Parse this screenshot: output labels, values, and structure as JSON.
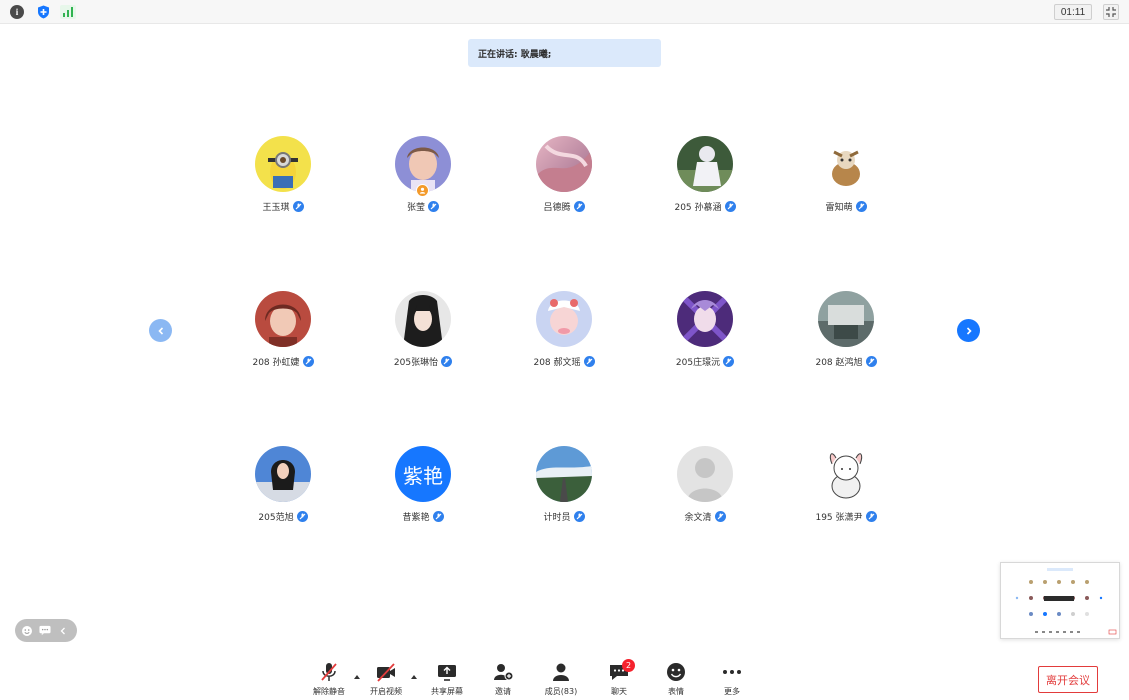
{
  "topbar": {
    "timer": "01:11",
    "icons": [
      "info-icon",
      "shield-icon",
      "signal-icon",
      "exit-fullscreen-icon"
    ]
  },
  "speaking": {
    "text": "正在讲话: 耿晨曦;"
  },
  "participants": [
    {
      "name": "王玉琪"
    },
    {
      "name": "张莹"
    },
    {
      "name": "吕德腾"
    },
    {
      "name": "205 孙慕涵"
    },
    {
      "name": "雷知萌"
    },
    {
      "name": "208 孙虹婕"
    },
    {
      "name": "205张琳怡"
    },
    {
      "name": "208 郝文瑶"
    },
    {
      "name": "205庄璟沅"
    },
    {
      "name": "208 赵鸿旭"
    },
    {
      "name": "205范旭"
    },
    {
      "name": "昔紫艳",
      "avatar_text": "紫艳"
    },
    {
      "name": "计时员"
    },
    {
      "name": "余文清"
    },
    {
      "name": "195 张潇尹"
    }
  ],
  "toolbar": {
    "unmute": "解除静音",
    "start_video": "开启视频",
    "share_screen": "共享屏幕",
    "invite": "邀请",
    "members": "成员(83)",
    "chat": "聊天",
    "chat_badge": "2",
    "reactions": "表情",
    "more": "更多",
    "leave": "离开会议"
  },
  "colors": {
    "accent": "#1677ff",
    "leave": "#e23b3b",
    "speaking_bg": "#dbe9fb"
  }
}
